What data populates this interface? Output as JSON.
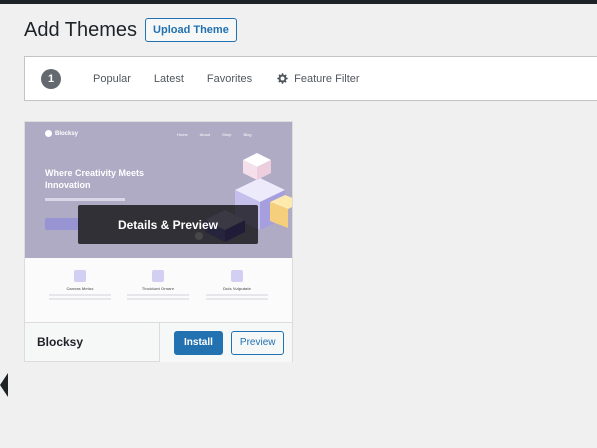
{
  "header": {
    "title": "Add Themes",
    "upload_label": "Upload Theme"
  },
  "filter_bar": {
    "count": "1",
    "links": [
      "Popular",
      "Latest",
      "Favorites"
    ],
    "feature_filter_label": "Feature Filter",
    "feature_filter_icon": "gear-icon"
  },
  "theme": {
    "name": "Blocksy",
    "details_label": "Details & Preview",
    "install_label": "Install",
    "preview_label": "Preview",
    "screenshot": {
      "logo": "Blocksy",
      "nav": [
        "Home",
        "About",
        "Shop",
        "Blog"
      ],
      "headline": "Where Creativity Meets Innovation",
      "features": [
        "Canvas Metus",
        "Tincidunt Ornare",
        "Duis Vulputate"
      ]
    }
  },
  "colors": {
    "accent": "#2271b1",
    "admin_bar": "#1d2327",
    "background": "#f0f0f1"
  }
}
